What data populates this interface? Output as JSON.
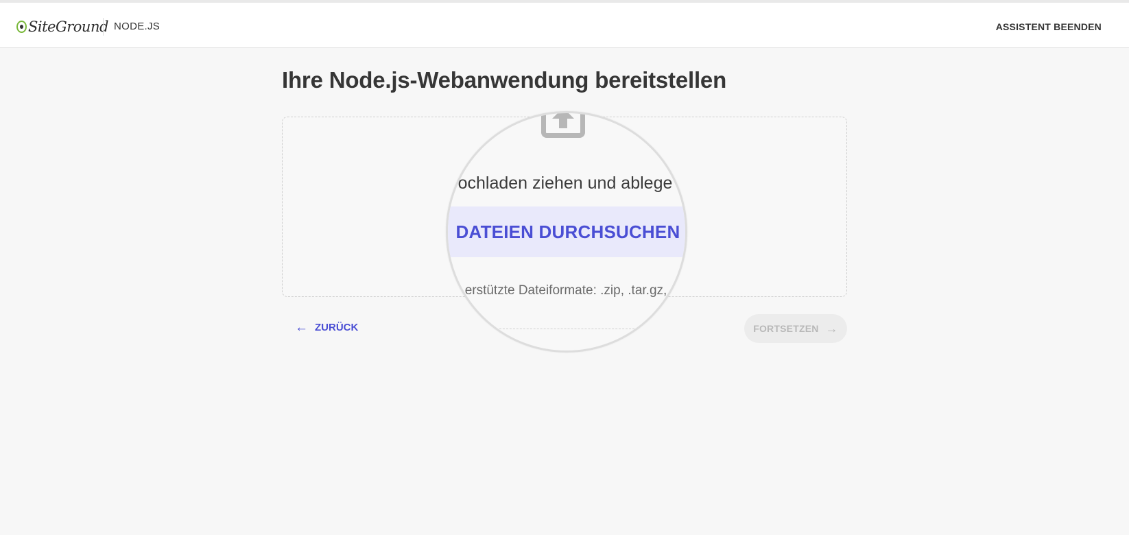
{
  "header": {
    "logo_text": "SiteGround",
    "section": "NODE.JS",
    "exit_label": "ASSISTENT BEENDEN"
  },
  "main": {
    "title": "Ihre Node.js-Webanwendung bereitstellen",
    "dropzone": {
      "drag_text": "ochladen ziehen und ablege",
      "browse_label": "DATEIEN DURCHSUCHEN",
      "formats_text": "erstützte Dateiformate: .zip, .tar.gz,"
    },
    "back_label": "ZURÜCK",
    "continue_label": "FORTSETZEN"
  },
  "colors": {
    "accent": "#4a4ed4",
    "brand_green": "#79b83a",
    "disabled": "#b8b8b8"
  },
  "icons": [
    "upload-icon",
    "arrow-left-icon",
    "arrow-right-icon",
    "siteground-logo-icon"
  ]
}
